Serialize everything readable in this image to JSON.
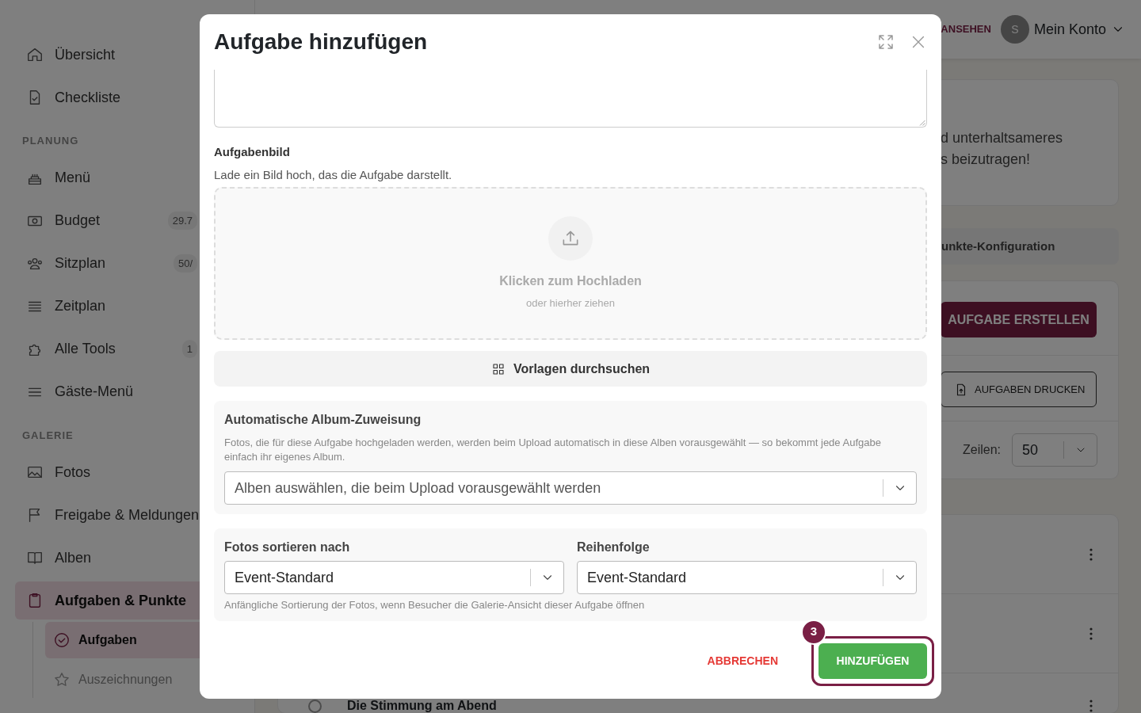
{
  "sidebar": {
    "groups": [
      {
        "items": [
          {
            "label": "Übersicht",
            "selected": false
          },
          {
            "label": "Checkliste",
            "selected": false
          }
        ]
      },
      {
        "heading": "PLANUNG",
        "items": [
          {
            "label": "Menü",
            "selected": false
          },
          {
            "label": "Budget",
            "badge": "29.7",
            "selected": false
          },
          {
            "label": "Sitzplan",
            "badge": "50/",
            "selected": false
          },
          {
            "label": "Zeitplan",
            "selected": false
          },
          {
            "label": "Alle Tools",
            "badge": "1",
            "selected": false
          },
          {
            "label": "Gäste-Menü",
            "selected": false
          }
        ]
      },
      {
        "heading": "GALERIE",
        "items": [
          {
            "label": "Fotos",
            "selected": false
          },
          {
            "label": "Freigabe & Meldungen",
            "selected": false
          },
          {
            "label": "Alben",
            "selected": false
          },
          {
            "label": "Aufgaben & Punkte",
            "selected": true,
            "children": [
              {
                "label": "Aufgaben",
                "selected": true
              },
              {
                "label": "Auszeichnungen",
                "selected": false
              }
            ]
          }
        ]
      }
    ]
  },
  "topbar": {
    "link": "ANSEHEN",
    "avatar": "S",
    "account": "Mein Konto"
  },
  "main": {
    "intro_lines": [
      "d unterhaltsameres",
      "s beizutragen!"
    ],
    "tab": "unkte-Konfiguration",
    "create_button": "AUFGABE ERSTELLEN",
    "print_button": "AUFGABEN DRUCKEN",
    "rows_label": "Zeilen:",
    "rows_value": "50",
    "task_rows": [
      {
        "kind": "hidden"
      },
      {
        "kind": "hidden"
      },
      {
        "kind": "titled",
        "title": "Die Stimmung am Abend",
        "checked": false
      }
    ]
  },
  "modal": {
    "title": "Aufgabe hinzufügen",
    "image": {
      "label": "Aufgabenbild",
      "hint": "Lade ein Bild hoch, das die Aufgabe darstellt.",
      "upload_title": "Klicken zum Hochladen",
      "upload_subtitle": "oder hierher ziehen"
    },
    "templates_button": "Vorlagen durchsuchen",
    "album": {
      "title": "Automatische Album-Zuweisung",
      "description": "Fotos, die für diese Aufgabe hochgeladen werden, werden beim Upload automatisch in diese Alben vorausgewählt — so bekommt jede Aufgabe einfach ihr eigenes Album.",
      "placeholder": "Alben auswählen, die beim Upload vorausgewählt werden"
    },
    "sorting": {
      "fields": [
        {
          "label": "Fotos sortieren nach",
          "value": "Event-Standard"
        },
        {
          "label": "Reihenfolge",
          "value": "Event-Standard"
        }
      ],
      "help": "Anfängliche Sortierung der Fotos, wenn Besucher die Galerie-Ansicht dieser Aufgabe öffnen"
    },
    "cancel_button": "ABBRECHEN",
    "submit_button": "HINZUFÜGEN",
    "step_badge": "3"
  }
}
